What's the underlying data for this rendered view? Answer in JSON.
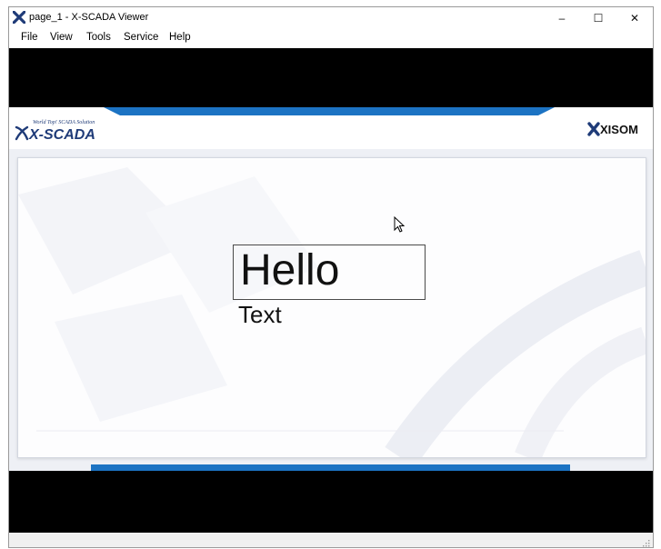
{
  "window": {
    "title": "page_1 - X-SCADA Viewer",
    "controls": {
      "minimize": "–",
      "maximize": "☐",
      "close": "✕"
    }
  },
  "menu": {
    "items": [
      "File",
      "View",
      "Tools",
      "Service",
      "Help"
    ]
  },
  "header": {
    "left_logo": {
      "tagline": "World Top! SCADA Solution",
      "name": "X-SCADA"
    },
    "right_logo": {
      "name": "XISOM"
    }
  },
  "canvas": {
    "hello_box_text": "Hello",
    "text_label": "Text"
  },
  "colors": {
    "accent_blue": "#1c73c3",
    "logo_navy": "#1f3b78",
    "black_band": "#000000"
  },
  "icons": [
    "x-scada-app-icon",
    "minimize-icon",
    "maximize-icon",
    "close-icon",
    "mouse-cursor-icon",
    "resize-grip-icon"
  ]
}
